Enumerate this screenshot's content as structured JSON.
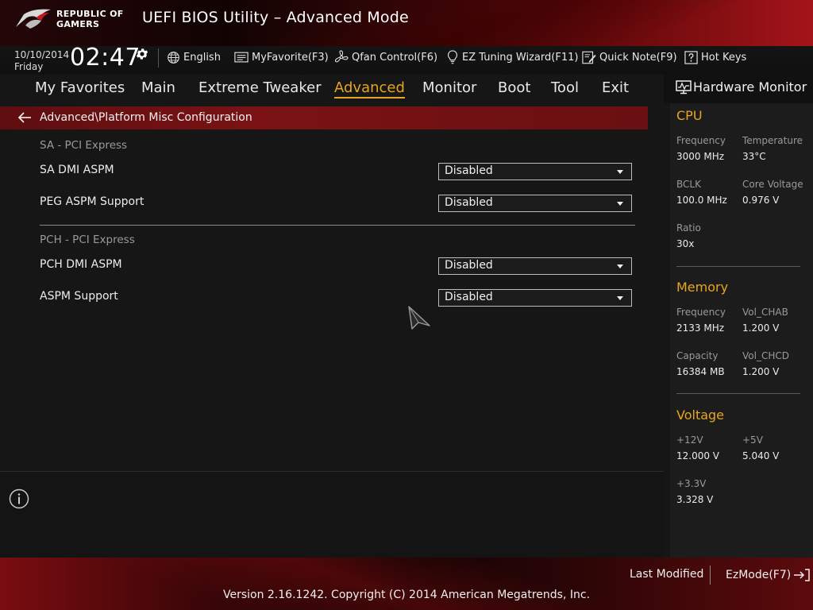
{
  "header": {
    "logo_line1": "REPUBLIC OF",
    "logo_line2": "GAMERS",
    "title": "UEFI BIOS Utility – Advanced Mode"
  },
  "status": {
    "date": "10/10/2014",
    "day": "Friday",
    "time": "02:47",
    "toolbar": {
      "language": "English",
      "my_favorite": "MyFavorite(F3)",
      "qfan": "Qfan Control(F6)",
      "ez_tuning": "EZ Tuning Wizard(F11)",
      "quick_note": "Quick Note(F9)",
      "hot_keys": "Hot Keys"
    }
  },
  "menu": {
    "items": [
      "My Favorites",
      "Main",
      "Extreme Tweaker",
      "Advanced",
      "Monitor",
      "Boot",
      "Tool",
      "Exit"
    ],
    "active": "Advanced"
  },
  "breadcrumb": "Advanced\\Platform Misc Configuration",
  "sections": [
    {
      "title": "SA - PCI Express",
      "options": [
        {
          "label": "SA DMI ASPM",
          "value": "Disabled"
        },
        {
          "label": "PEG ASPM Support",
          "value": "Disabled"
        }
      ]
    },
    {
      "title": "PCH - PCI Express",
      "options": [
        {
          "label": "PCH DMI ASPM",
          "value": "Disabled"
        },
        {
          "label": "ASPM Support",
          "value": "Disabled"
        }
      ]
    }
  ],
  "hw_monitor": {
    "title": "Hardware Monitor",
    "cpu": {
      "title": "CPU",
      "frequency_label": "Frequency",
      "frequency": "3000 MHz",
      "temperature_label": "Temperature",
      "temperature": "33°C",
      "bclk_label": "BCLK",
      "bclk": "100.0 MHz",
      "core_voltage_label": "Core Voltage",
      "core_voltage": "0.976 V",
      "ratio_label": "Ratio",
      "ratio": "30x"
    },
    "memory": {
      "title": "Memory",
      "frequency_label": "Frequency",
      "frequency": "2133 MHz",
      "vol_chab_label": "Vol_CHAB",
      "vol_chab": "1.200 V",
      "capacity_label": "Capacity",
      "capacity": "16384 MB",
      "vol_chcd_label": "Vol_CHCD",
      "vol_chcd": "1.200 V"
    },
    "voltage": {
      "title": "Voltage",
      "v12_label": "+12V",
      "v12": "12.000 V",
      "v5_label": "+5V",
      "v5": "5.040 V",
      "v33_label": "+3.3V",
      "v33": "3.328 V"
    }
  },
  "footer": {
    "last_modified": "Last Modified",
    "ezmode": "EzMode(F7)",
    "copyright": "Version 2.16.1242. Copyright (C) 2014 American Megatrends, Inc."
  },
  "colors": {
    "accent": "#e8a520",
    "brand_red": "#7a1214"
  }
}
